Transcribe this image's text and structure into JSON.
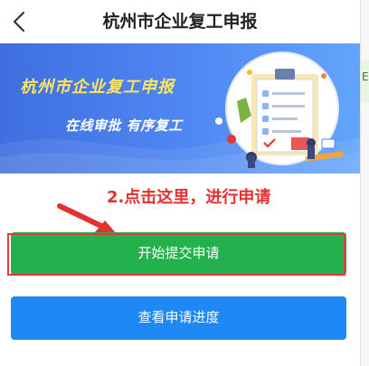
{
  "header": {
    "title": "杭州市企业复工申报",
    "back_icon": "chevron-left-icon"
  },
  "banner": {
    "title": "杭州市企业复工申报",
    "subtitle": "在线审批 有序复工",
    "illustration": "clipboard-checklist-illustration",
    "colors": {
      "bg_start": "#3f6fe0",
      "bg_end": "#63a5fb",
      "title": "#ffe45e"
    }
  },
  "annotation": {
    "text": "2.点击这里，进行申请",
    "arrow_icon": "arrow-pointer-icon",
    "color": "#e53030"
  },
  "buttons": {
    "start_label": "开始提交申请",
    "progress_label": "查看申请进度",
    "start_color": "#22b14c",
    "progress_color": "#1e88f5"
  },
  "side": {
    "glyph": "E"
  }
}
